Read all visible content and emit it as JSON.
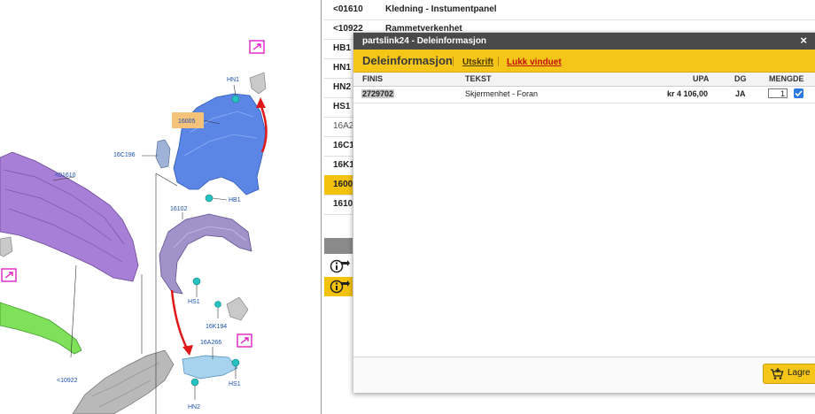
{
  "diagram": {
    "callouts": {
      "c01610": "<01610",
      "c10922": "<10922",
      "c16C196": "16C196",
      "c16102": "16102",
      "c16005": "16005",
      "cHN1": "HN1",
      "cHB1": "HB1",
      "cHS1a": "HS1",
      "cHS1b": "HS1",
      "cHN2": "HN2",
      "c16K194": "16K194",
      "c16A266": "16A266"
    }
  },
  "parts_list": {
    "rows": [
      {
        "code": "<01610",
        "name": "Kledning - Instumentpanel"
      },
      {
        "code": "<10922",
        "name": "Rammetverkenhet"
      },
      {
        "code": "HB1",
        "name": ""
      },
      {
        "code": "HN1",
        "name": ""
      },
      {
        "code": "HN2",
        "name": ""
      },
      {
        "code": "HS1",
        "name": ""
      },
      {
        "code": "16A2",
        "name": ""
      },
      {
        "code": "16C1",
        "name": ""
      },
      {
        "code": "16K1",
        "name": ""
      },
      {
        "code": "1600",
        "name": ""
      },
      {
        "code": "1610",
        "name": ""
      }
    ],
    "selected_index": 9
  },
  "dialog": {
    "title": "partslink24 - Deleinformasjon",
    "close": "×",
    "heading": "Deleinformasjon",
    "print_link": "Utskrift",
    "close_link": "Lukk vinduet",
    "columns": {
      "finis": "FINIS",
      "tekst": "TEKST",
      "upa": "UPA",
      "dg": "DG",
      "mengde": "MENGDE"
    },
    "row": {
      "finis": "2729702",
      "tekst": "Skjermenhet - Foran",
      "upa": "kr 4 106,00",
      "dg": "JA",
      "quantity": "1",
      "checked": true
    },
    "save_button": "Lagre"
  },
  "colors": {
    "accent": "#f5c518",
    "titlebar": "#4a4a4a",
    "callout": "#1a4fb0"
  }
}
